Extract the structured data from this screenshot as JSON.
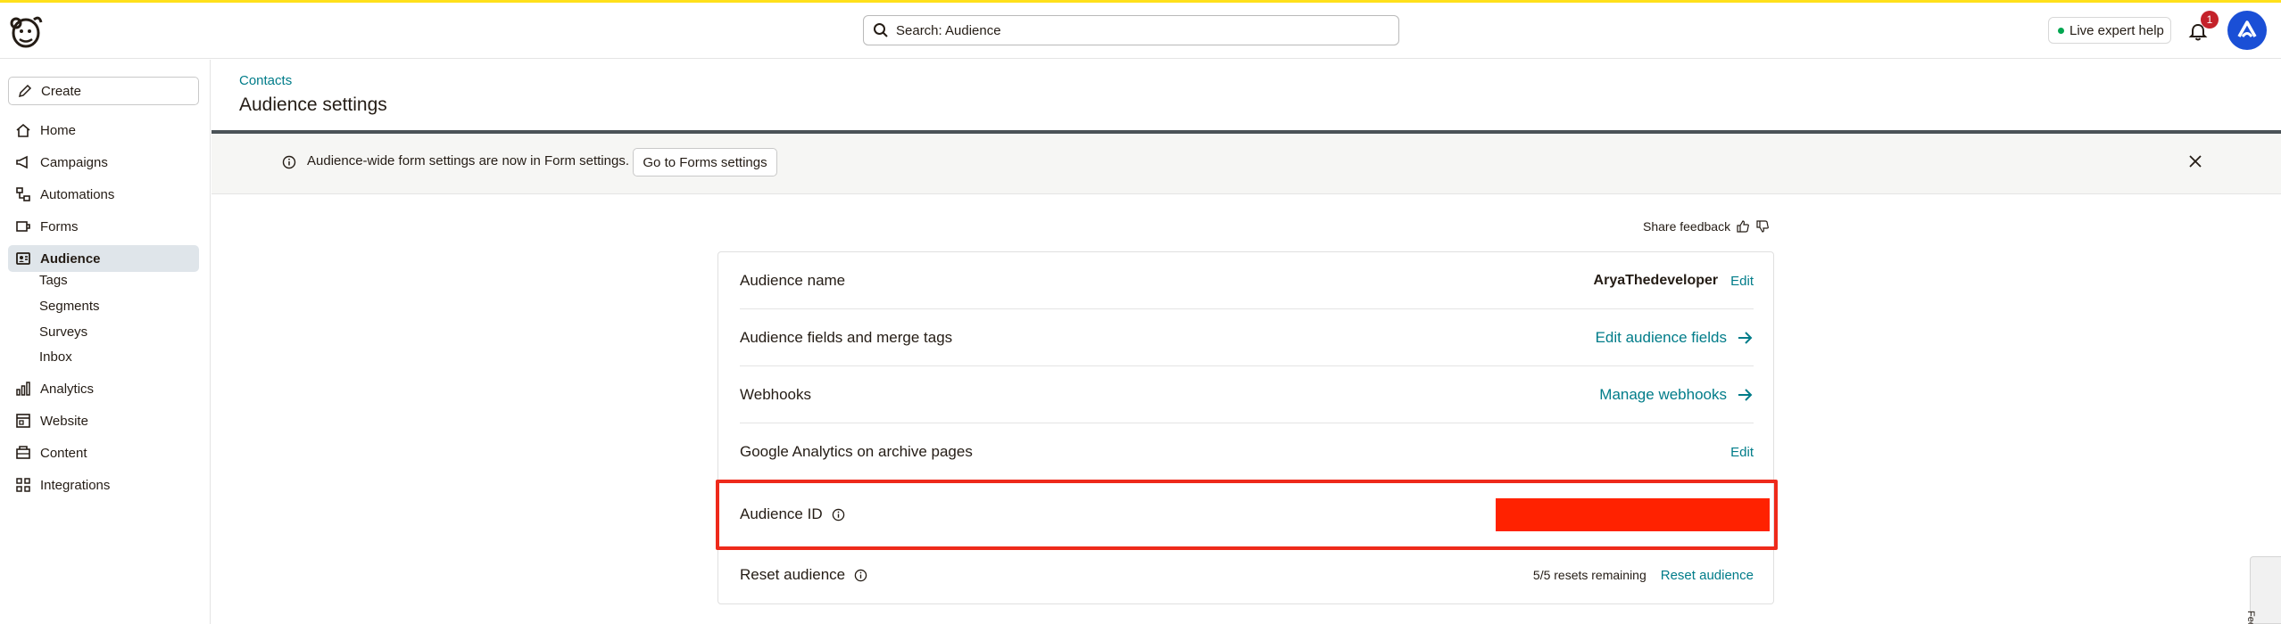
{
  "header": {
    "search_text": "Search: Audience",
    "live_help": "Live expert help",
    "notification_count": "1"
  },
  "sidebar": {
    "create_label": "Create",
    "items": [
      {
        "label": "Home",
        "icon": "home-icon"
      },
      {
        "label": "Campaigns",
        "icon": "megaphone-icon"
      },
      {
        "label": "Automations",
        "icon": "automation-icon"
      },
      {
        "label": "Forms",
        "icon": "forms-icon"
      },
      {
        "label": "Audience",
        "icon": "audience-icon"
      },
      {
        "label": "Analytics",
        "icon": "bar-chart-icon"
      },
      {
        "label": "Website",
        "icon": "website-icon"
      },
      {
        "label": "Content",
        "icon": "content-icon"
      },
      {
        "label": "Integrations",
        "icon": "grid-icon"
      }
    ],
    "audience_subitems": [
      "Tags",
      "Segments",
      "Surveys",
      "Inbox"
    ],
    "active_item": "Audience"
  },
  "main": {
    "breadcrumb": "Contacts",
    "page_title": "Audience settings",
    "banner": {
      "text": "Audience-wide form settings are now in Form settings.",
      "button_label": "Go to Forms settings"
    },
    "share_feedback": "Share feedback",
    "settings": {
      "audience_name": {
        "label": "Audience name",
        "value": "AryaThedeveloper",
        "action": "Edit"
      },
      "fields": {
        "label": "Audience fields and merge tags",
        "action": "Edit audience fields"
      },
      "webhooks": {
        "label": "Webhooks",
        "action": "Manage webhooks"
      },
      "google_analytics": {
        "label": "Google Analytics on archive pages",
        "action": "Edit"
      },
      "audience_id": {
        "label": "Audience ID"
      },
      "reset": {
        "label": "Reset audience",
        "remaining": "5/5 resets remaining",
        "action": "Reset audience"
      }
    },
    "feedback_tab": "Feedback"
  },
  "colors": {
    "accent": "#ffe01b",
    "link": "#007c89",
    "highlight": "#ee2a1b",
    "redaction": "#ff2200",
    "avatar": "#1a4fd6"
  }
}
